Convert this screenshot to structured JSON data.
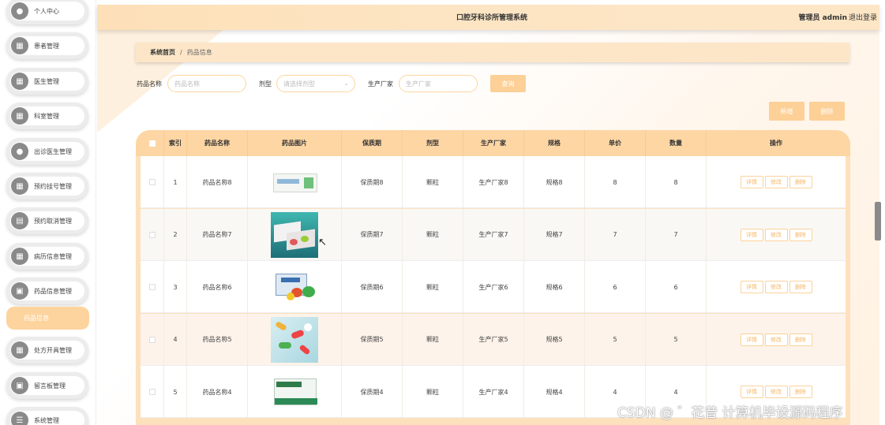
{
  "header": {
    "title": "口腔牙科诊所管理系统",
    "user": "管理员 admin",
    "logout": "退出登录"
  },
  "sidebar": {
    "items": [
      {
        "label": "个人中心",
        "icon": "user-icon"
      },
      {
        "label": "患者管理",
        "icon": "grid-icon"
      },
      {
        "label": "医生管理",
        "icon": "grid-icon"
      },
      {
        "label": "科室管理",
        "icon": "grid-icon"
      },
      {
        "label": "出诊医生管理",
        "icon": "user-icon"
      },
      {
        "label": "预约挂号管理",
        "icon": "grid-icon"
      },
      {
        "label": "预约取消管理",
        "icon": "document-icon"
      },
      {
        "label": "病历信息管理",
        "icon": "grid-icon"
      },
      {
        "label": "药品信息管理",
        "icon": "chat-icon"
      },
      {
        "label": "处方开具管理",
        "icon": "grid-icon"
      },
      {
        "label": "留言板管理",
        "icon": "chat-icon"
      },
      {
        "label": "系统管理",
        "icon": "list-icon"
      }
    ],
    "active_sub": "药品信息"
  },
  "breadcrumb": {
    "home": "系统首页",
    "separator": "/",
    "current": "药品信息"
  },
  "search": {
    "name_label": "药品名称",
    "name_placeholder": "药品名称",
    "type_label": "剂型",
    "type_placeholder": "请选择剂型",
    "maker_label": "生产厂家",
    "maker_placeholder": "生产厂家",
    "query_button": "查询"
  },
  "actions": {
    "add_button": "新增",
    "delete_button": "删除"
  },
  "table": {
    "columns": [
      "索引",
      "药品名称",
      "药品图片",
      "保质期",
      "剂型",
      "生产厂家",
      "规格",
      "单价",
      "数量",
      "操作"
    ],
    "op_labels": {
      "detail": "详情",
      "edit": "修改",
      "delete": "删除"
    },
    "rows": [
      {
        "index": "1",
        "name": "药品名称8",
        "shelf": "保质期8",
        "form": "颗粒",
        "maker": "生产厂家8",
        "spec": "规格8",
        "price": "8",
        "qty": "8"
      },
      {
        "index": "2",
        "name": "药品名称7",
        "shelf": "保质期7",
        "form": "颗粒",
        "maker": "生产厂家7",
        "spec": "规格7",
        "price": "7",
        "qty": "7"
      },
      {
        "index": "3",
        "name": "药品名称6",
        "shelf": "保质期6",
        "form": "颗粒",
        "maker": "生产厂家6",
        "spec": "规格6",
        "price": "6",
        "qty": "6"
      },
      {
        "index": "4",
        "name": "药品名称5",
        "shelf": "保质期5",
        "form": "颗粒",
        "maker": "生产厂家5",
        "spec": "规格5",
        "price": "5",
        "qty": "5"
      },
      {
        "index": "5",
        "name": "药品名称4",
        "shelf": "保质期4",
        "form": "颗粒",
        "maker": "生产厂家4",
        "spec": "规格4",
        "price": "4",
        "qty": "4"
      }
    ]
  },
  "watermark": "CSDN @ ゛花昔 计算机毕设源码程序",
  "colors": {
    "accent": "#fdd097",
    "header_bg": "#fde0b8",
    "table_head": "#fdd6a4",
    "op_border": "#fcd29a"
  }
}
